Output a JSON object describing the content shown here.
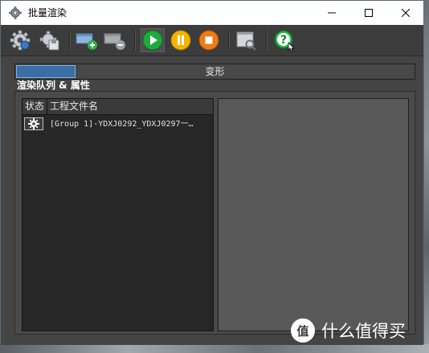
{
  "window": {
    "title": "批量渲染",
    "controls": {
      "minimize": "minimize",
      "maximize": "maximize",
      "close": "close"
    }
  },
  "toolbar": {
    "buttons": [
      {
        "icon": "settings-gear-icon"
      },
      {
        "icon": "save-render-icon"
      },
      {
        "icon": "add-job-icon"
      },
      {
        "icon": "remove-job-icon"
      },
      {
        "icon": "play-icon"
      },
      {
        "icon": "pause-icon"
      },
      {
        "icon": "stop-icon"
      },
      {
        "icon": "preview-window-icon"
      },
      {
        "icon": "help-icon"
      }
    ],
    "colors": {
      "play": "#1faa3a",
      "pause": "#f2b600",
      "stop": "#f07a1a",
      "help": "#2eb34a"
    }
  },
  "progress": {
    "label": "变形",
    "fraction": 0.15,
    "fill_color": "#3a6ea5"
  },
  "queue": {
    "section_label": "渲染队列 & 属性",
    "columns": [
      "状态",
      "工程文件名"
    ],
    "rows": [
      {
        "status_icon": "gear-icon",
        "filename": "[Group 1]-YDXJ0292_YDXJ0297一…"
      }
    ]
  },
  "watermark": {
    "text": "什么值得买",
    "logo_char": "值"
  }
}
